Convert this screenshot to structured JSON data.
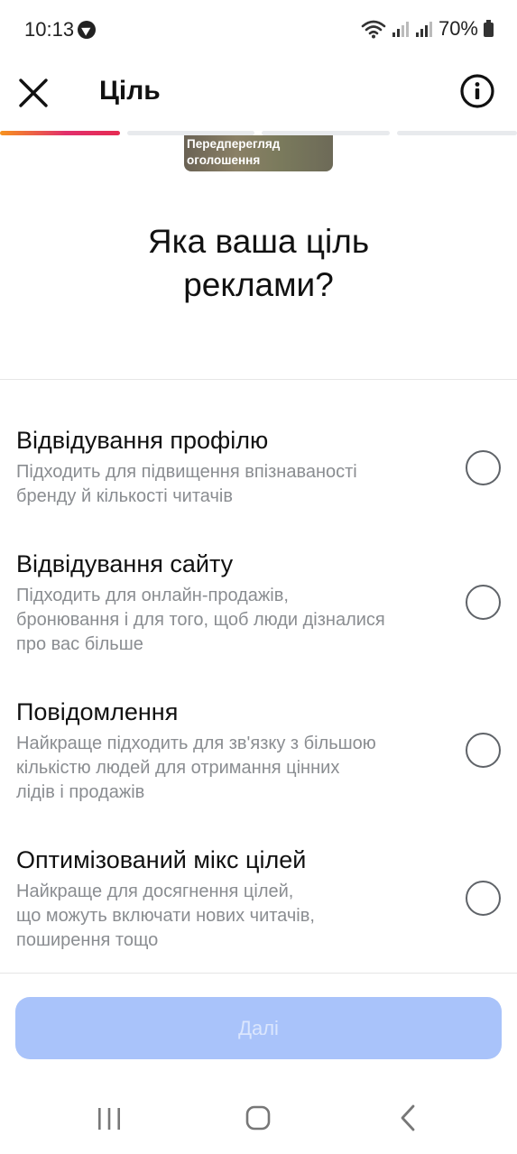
{
  "status_bar": {
    "time": "10:13",
    "battery": "70%",
    "icons": [
      "messenger-icon",
      "wifi-icon",
      "signal-icon",
      "signal-icon",
      "battery-icon"
    ]
  },
  "header": {
    "title": "Ціль",
    "close_icon": "close-icon",
    "info_icon": "info-icon"
  },
  "progress": {
    "segments": 4,
    "active_segment": 1,
    "active_gradient": [
      "#f7931e",
      "#e1306c",
      "#e62b52"
    ]
  },
  "ad_preview": {
    "label_line1": "Передперегляд",
    "label_line2": "оголошення"
  },
  "question": {
    "line1": "Яка ваша ціль",
    "line2": "реклами?"
  },
  "options": [
    {
      "title": "Відвідування профілю",
      "desc_lines": [
        "Підходить для підвищення впізнаваності",
        "бренду й кількості читачів"
      ],
      "selected": false
    },
    {
      "title": "Відвідування сайту",
      "desc_lines": [
        "Підходить для онлайн-продажів,",
        "бронювання і для того, щоб люди дізналися",
        "про вас більше"
      ],
      "selected": false
    },
    {
      "title": "Повідомлення",
      "desc_lines": [
        "Найкраще підходить для зв'язку з більшою",
        "кількістю людей для отримання цінних",
        "лідів і продажів"
      ],
      "selected": false
    },
    {
      "title": "Оптимізований мікс цілей",
      "desc_lines": [
        "Найкраще для досягнення цілей,",
        "що можуть включати нових читачів,",
        "поширення тощо"
      ],
      "selected": false
    }
  ],
  "next_button": {
    "label": "Далі",
    "enabled": false,
    "color": "#a9c3fa"
  },
  "nav_bar": {
    "icons": [
      "recent-apps-icon",
      "home-icon",
      "back-icon"
    ]
  }
}
